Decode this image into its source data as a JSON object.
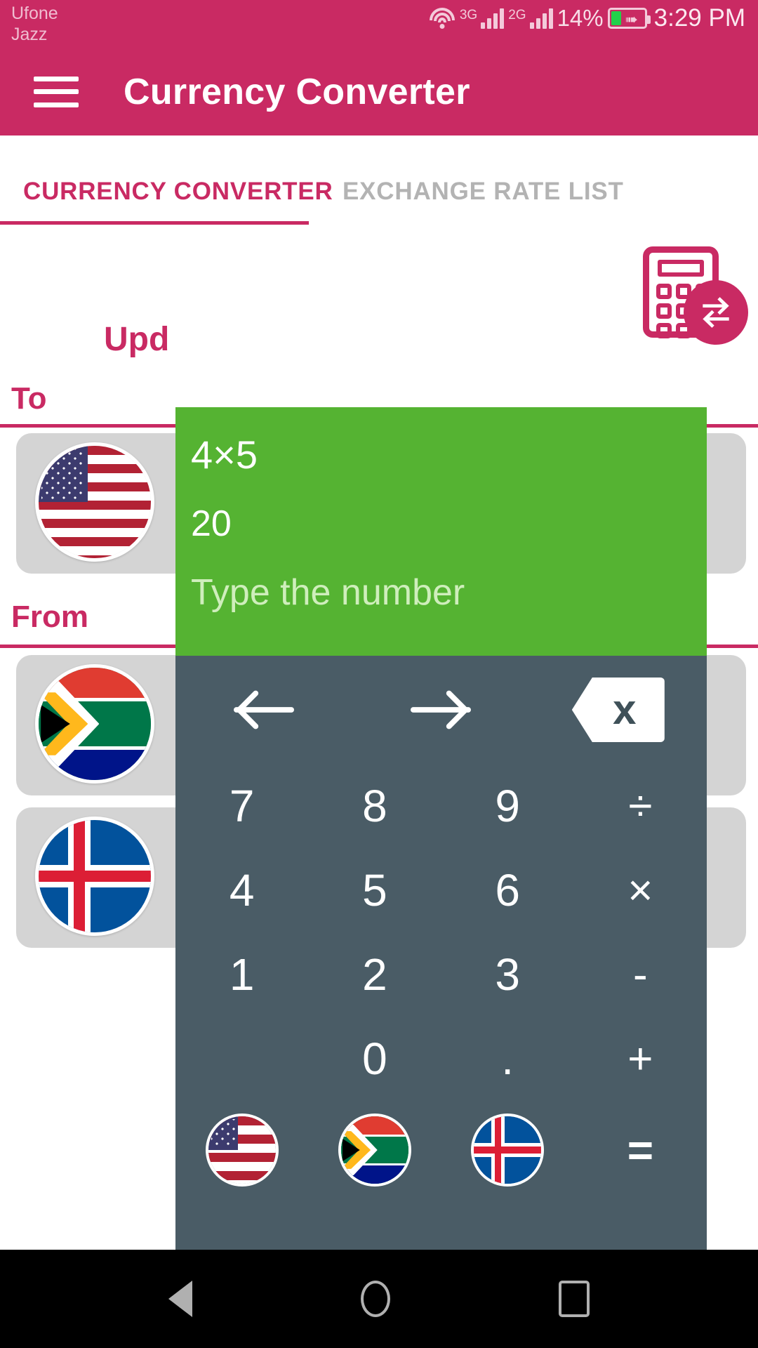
{
  "status_bar": {
    "carrier_1": "Ufone",
    "carrier_2": "Jazz",
    "wifi_icon": "wifi-icon",
    "network_1": "3G",
    "network_2": "2G",
    "battery_percent": "14%",
    "battery_icon": "battery-charging-icon",
    "time": "3:29 PM"
  },
  "app_bar": {
    "menu_icon": "hamburger-menu-icon",
    "title": "Currency Converter"
  },
  "tabs": [
    {
      "label": "CURRENCY CONVERTER",
      "active": true
    },
    {
      "label": "EXCHANGE RATE LIST",
      "active": false
    }
  ],
  "content": {
    "calculator_fab": {
      "icon": "calculator-icon",
      "badge_icon": "exchange-arrows-icon"
    },
    "update_text": "Upd",
    "to_label": "To",
    "from_label": "From",
    "cards": [
      {
        "flag": "us-flag-icon",
        "section": "to"
      },
      {
        "flag": "za-flag-icon",
        "section": "from"
      },
      {
        "flag": "is-flag-icon",
        "section": "from"
      }
    ]
  },
  "calculator": {
    "display": {
      "expression": "4×5",
      "result": "20",
      "hint": "Type the number"
    },
    "nav_row": [
      {
        "name": "arrow-left-icon",
        "label": "←"
      },
      {
        "name": "arrow-right-icon",
        "label": "→"
      },
      {
        "name": "backspace-icon",
        "label": "x"
      }
    ],
    "rows": [
      [
        "7",
        "8",
        "9",
        "÷"
      ],
      [
        "4",
        "5",
        "6",
        "×"
      ],
      [
        "1",
        "2",
        "3",
        "-"
      ],
      [
        "",
        "0",
        ".",
        "+"
      ]
    ],
    "flag_row": {
      "flags": [
        "us-flag-icon",
        "za-flag-icon",
        "is-flag-icon"
      ],
      "equals": "="
    },
    "colors": {
      "display_bg": "#55b332",
      "keypad_bg": "#4a5c66",
      "accent": "#c92a63"
    }
  },
  "nav_bar": {
    "back_icon": "android-back-icon",
    "home_icon": "android-home-icon",
    "recents_icon": "android-recents-icon"
  }
}
